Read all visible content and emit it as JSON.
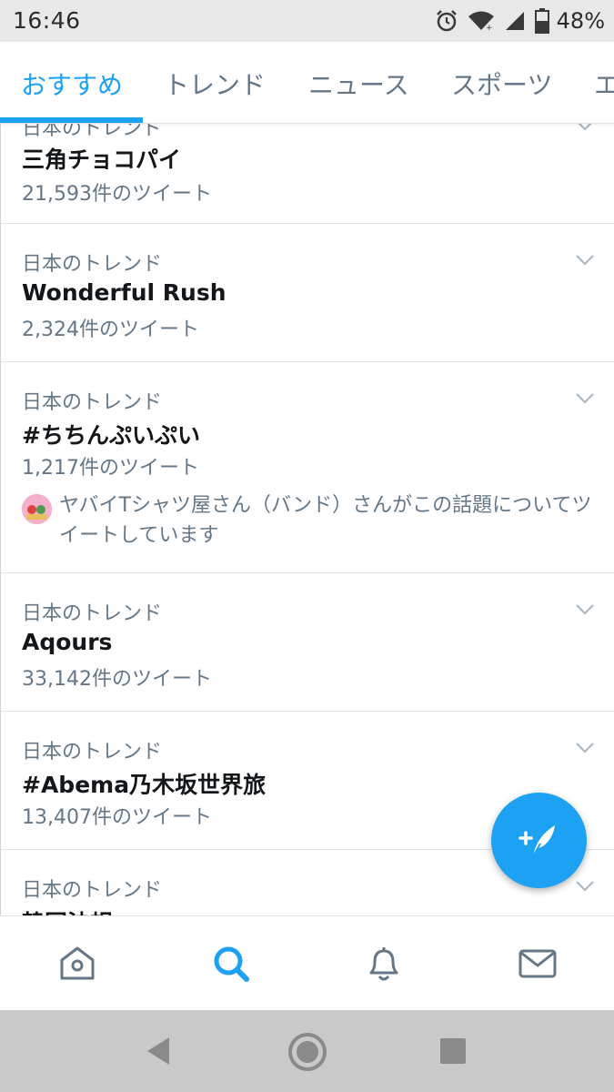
{
  "status_bar": {
    "time": "16:46",
    "battery": "48%"
  },
  "tabs": [
    {
      "label": "おすすめ",
      "active": true
    },
    {
      "label": "トレンド",
      "active": false
    },
    {
      "label": "ニュース",
      "active": false
    },
    {
      "label": "スポーツ",
      "active": false
    },
    {
      "label": "エ",
      "active": false
    }
  ],
  "trends": [
    {
      "context": "日本のトレンド",
      "name": "三角チョコパイ",
      "count": "21,593件のツイート"
    },
    {
      "context": "日本のトレンド",
      "name": "Wonderful Rush",
      "count": "2,324件のツイート"
    },
    {
      "context": "日本のトレンド",
      "name": "#ちちんぷいぷい",
      "count": "1,217件のツイート",
      "description": "ヤバイTシャツ屋さん（バンド）さんがこの話題についてツイートしています"
    },
    {
      "context": "日本のトレンド",
      "name": "Aqours",
      "count": "33,142件のツイート"
    },
    {
      "context": "日本のトレンド",
      "name": "#Abema乃木坂世界旅",
      "count": "13,407件のツイート"
    },
    {
      "context": "日本のトレンド",
      "name": "韓国法規",
      "count": ""
    }
  ],
  "icons": {
    "compose": "compose-tweet-icon",
    "home": "home-icon",
    "search": "search-icon",
    "notifications": "bell-icon",
    "messages": "mail-icon"
  },
  "colors": {
    "accent": "#1da1f2",
    "secondary_text": "#657786",
    "primary_text": "#14171a"
  }
}
